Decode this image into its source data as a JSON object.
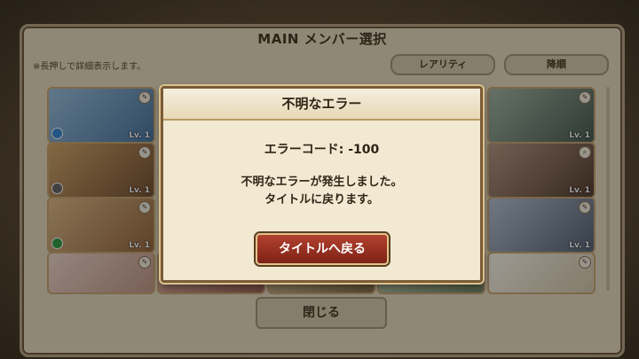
{
  "screen": {
    "title": "MAIN メンバー選択",
    "hint": "※長押しで詳細表示します。",
    "sort_rarity": "レアリティ",
    "sort_order": "降順",
    "close": "閉じる"
  },
  "cards": [
    {
      "lv": "Lv. 1",
      "color": "#7aa7c9",
      "dot": "#3a88d6"
    },
    {
      "lv": "Lv. 1",
      "color": "#b78d58",
      "dot": "#6a6a6a"
    },
    {
      "lv": "Lv. 1",
      "color": "#c9a47a",
      "dot": "#35a04a"
    },
    {
      "lv": "",
      "color": "#d9c0b4",
      "dot": ""
    },
    {
      "lv": "Lv. 1",
      "color": "#6f8a7a",
      "dot": ""
    },
    {
      "lv": "Lv. 1",
      "color": "#8b7060",
      "dot": ""
    },
    {
      "lv": "Lv. 1",
      "color": "#7f8ea0",
      "dot": ""
    },
    {
      "lv": "",
      "color": "#e8e0d0",
      "dot": ""
    }
  ],
  "dialog": {
    "title": "不明なエラー",
    "code": "エラーコード: -100",
    "line1": "不明なエラーが発生しました。",
    "line2": "タイトルに戻ります。",
    "button": "タイトルへ戻る"
  }
}
